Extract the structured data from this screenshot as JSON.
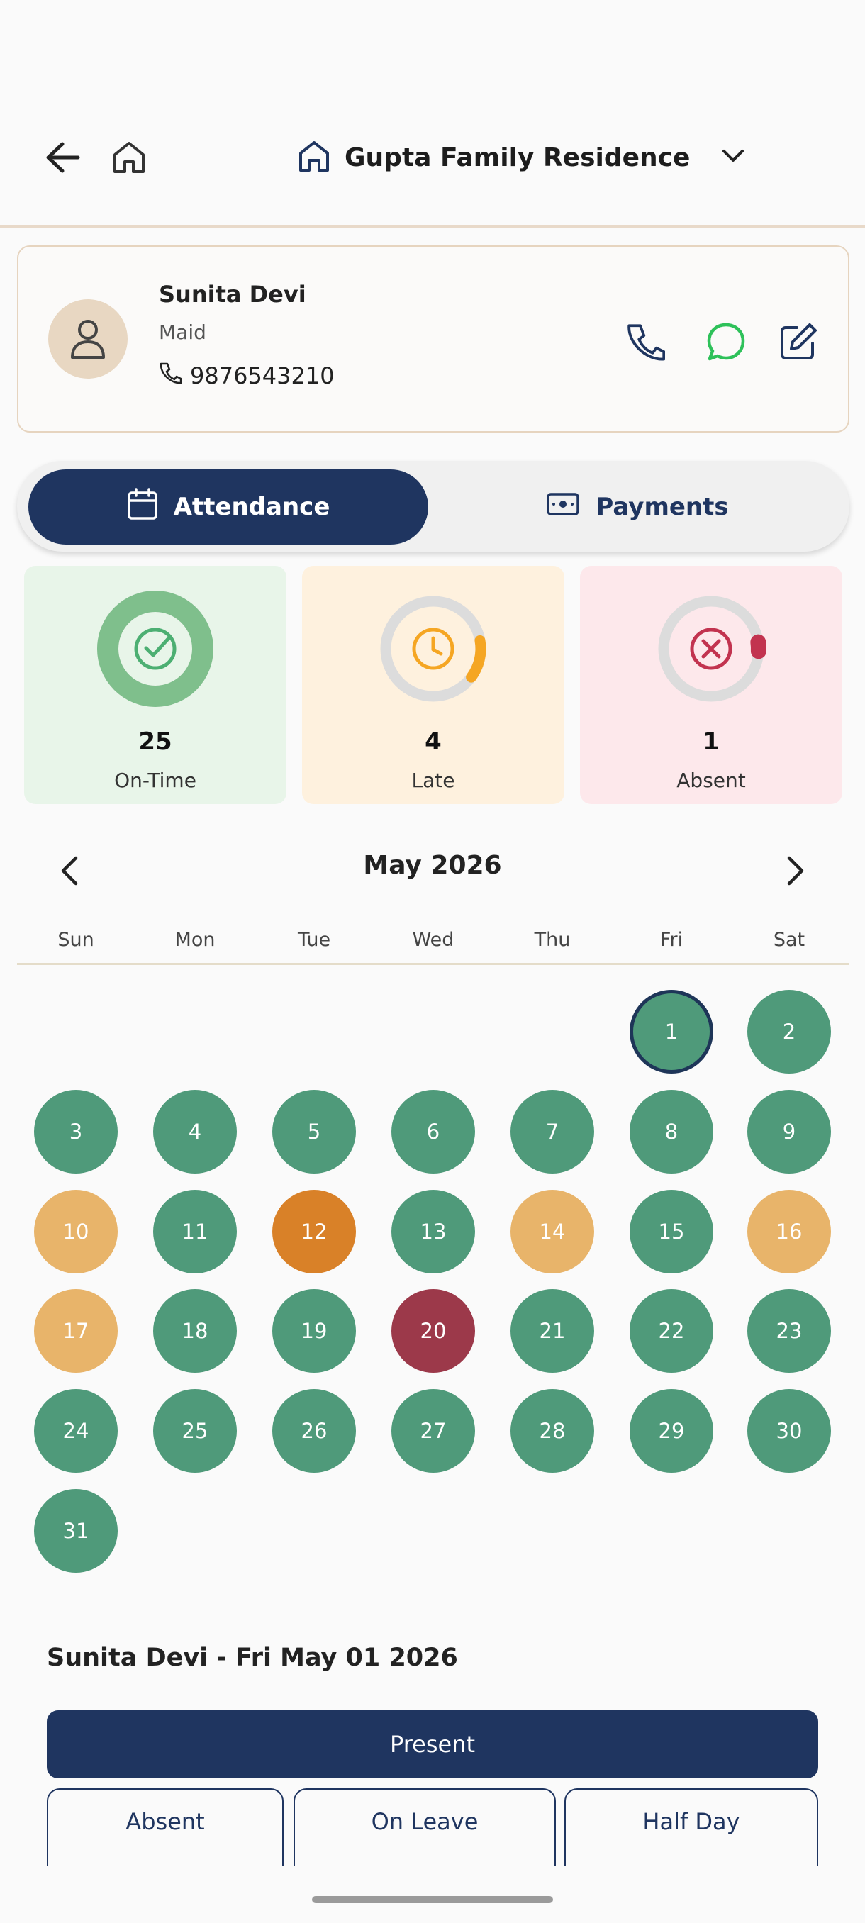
{
  "header": {
    "residence_name": "Gupta Family Residence",
    "icons": [
      "back-arrow-icon",
      "home-icon",
      "house-icon",
      "chevron-down-icon"
    ]
  },
  "profile": {
    "name": "Sunita Devi",
    "role": "Maid",
    "phone": "9876543210",
    "actions": [
      "phone-icon",
      "whatsapp-icon",
      "edit-icon"
    ]
  },
  "tabs": [
    {
      "label": "Attendance",
      "icon": "calendar-icon",
      "active": true
    },
    {
      "label": "Payments",
      "icon": "money-icon",
      "active": false
    }
  ],
  "stats": [
    {
      "value": "25",
      "label": "On-Time",
      "fill_fraction": 1.0,
      "color": "#4caf72"
    },
    {
      "value": "4",
      "label": "Late",
      "fill_fraction": 0.13,
      "color": "#f5a623"
    },
    {
      "value": "1",
      "label": "Absent",
      "fill_fraction": 0.03,
      "color": "#c2334f"
    }
  ],
  "calendar": {
    "month_label": "May 2026",
    "weekdays": [
      "Sun",
      "Mon",
      "Tue",
      "Wed",
      "Thu",
      "Fri",
      "Sat"
    ],
    "first_weekday_index": 5,
    "days": [
      {
        "d": "1",
        "s": "ontime",
        "selected": true
      },
      {
        "d": "2",
        "s": "ontime"
      },
      {
        "d": "3",
        "s": "ontime"
      },
      {
        "d": "4",
        "s": "ontime"
      },
      {
        "d": "5",
        "s": "ontime"
      },
      {
        "d": "6",
        "s": "ontime"
      },
      {
        "d": "7",
        "s": "ontime"
      },
      {
        "d": "8",
        "s": "ontime"
      },
      {
        "d": "9",
        "s": "ontime"
      },
      {
        "d": "10",
        "s": "late"
      },
      {
        "d": "11",
        "s": "ontime"
      },
      {
        "d": "12",
        "s": "halfday"
      },
      {
        "d": "13",
        "s": "ontime"
      },
      {
        "d": "14",
        "s": "late"
      },
      {
        "d": "15",
        "s": "ontime"
      },
      {
        "d": "16",
        "s": "late"
      },
      {
        "d": "17",
        "s": "late"
      },
      {
        "d": "18",
        "s": "ontime"
      },
      {
        "d": "19",
        "s": "ontime"
      },
      {
        "d": "20",
        "s": "absent"
      },
      {
        "d": "21",
        "s": "ontime"
      },
      {
        "d": "22",
        "s": "ontime"
      },
      {
        "d": "23",
        "s": "ontime"
      },
      {
        "d": "24",
        "s": "ontime"
      },
      {
        "d": "25",
        "s": "ontime"
      },
      {
        "d": "26",
        "s": "ontime"
      },
      {
        "d": "27",
        "s": "ontime"
      },
      {
        "d": "28",
        "s": "ontime"
      },
      {
        "d": "29",
        "s": "ontime"
      },
      {
        "d": "30",
        "s": "ontime"
      },
      {
        "d": "31",
        "s": "ontime"
      }
    ]
  },
  "selection": {
    "title": "Sunita Devi - Fri May 01 2026",
    "present_label": "Present",
    "other_labels": [
      "Absent",
      "On Leave",
      "Half Day"
    ]
  }
}
